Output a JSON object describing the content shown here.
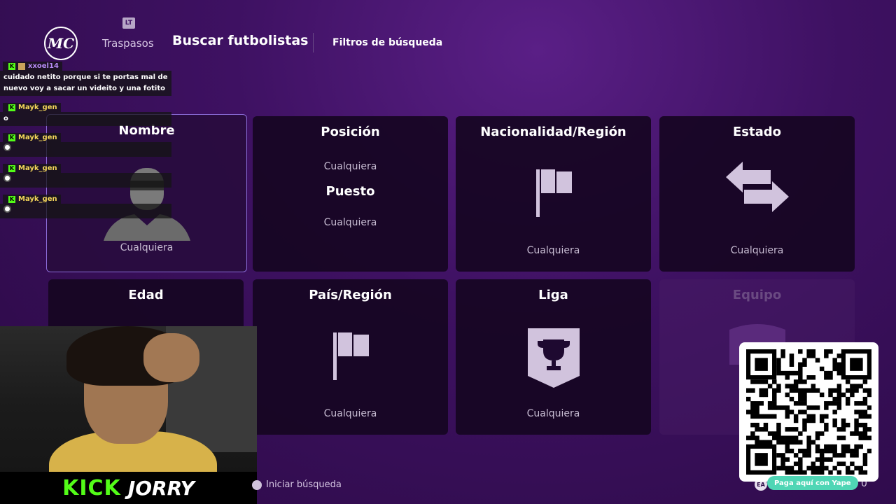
{
  "nav": {
    "logo_text": "MC",
    "lt_label": "LT",
    "transfers": "Traspasos",
    "search_players": "Buscar futbolistas",
    "search_filters": "Filtros de búsqueda"
  },
  "cards": {
    "name": {
      "title": "Nombre",
      "value": "Cualquiera"
    },
    "position": {
      "title": "Posición",
      "value": "Cualquiera",
      "sub_title": "Puesto",
      "sub_value": "Cualquiera"
    },
    "nationality": {
      "title": "Nacionalidad/Región",
      "value": "Cualquiera"
    },
    "status": {
      "title": "Estado",
      "value": "Cualquiera"
    },
    "age": {
      "title": "Edad"
    },
    "country": {
      "title": "País/Región",
      "value": "Cualquiera"
    },
    "league": {
      "title": "Liga",
      "value": "Cualquiera"
    },
    "team": {
      "title": "Equipo"
    }
  },
  "chat": {
    "messages": [
      {
        "user": "xxoel14",
        "text": "cuidado netito porque si te portas mal de nuevo voy a sacar un videito y una fotito"
      },
      {
        "user": "Mayk_gen",
        "text": "o"
      },
      {
        "user": "Mayk_gen",
        "text": ""
      },
      {
        "user": "Mayk_gen",
        "text": ""
      },
      {
        "user": "Mayk_gen",
        "text": ""
      }
    ]
  },
  "stream": {
    "platform": "KICK",
    "username": "JORRY"
  },
  "footer": {
    "start_search": "Iniciar búsqueda",
    "counter": "0",
    "ea_label": "EA"
  },
  "qr": {
    "caption": "Paga aquí con Yape"
  },
  "colors": {
    "accent": "#8b6cd8",
    "kick_green": "#53fc18",
    "yape_teal": "#4fd6b5"
  }
}
